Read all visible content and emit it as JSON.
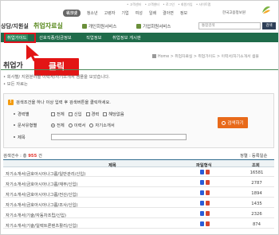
{
  "top_links": [
    "• 고객센터",
    "• 고객센터",
    "• 로그인",
    "• 회원가입",
    "• 사이트맵"
  ],
  "gnb": {
    "items": [
      "워크넷",
      "청소년",
      "고령자",
      "기업",
      "여성",
      "일배",
      "결아면",
      "정보"
    ],
    "active_index": 0
  },
  "logo": {
    "text": "한국고용정보원"
  },
  "row2": {
    "title_part1": "상담/지원실",
    "title_part2": "취업자료실",
    "tab1": "개인회원서비스",
    "tab2": "기업회원서비스",
    "search_placeholder": "통합검색",
    "search_button": "검색"
  },
  "green_nav": {
    "items": [
      "취업가이드",
      "선호직종/임금정보",
      "직업정보",
      "취업정보 게시판"
    ],
    "selected_index": 0
  },
  "click_badge": "클릭",
  "breadcrumb": "Home > 취업자료실 > 취업가이드 > 이력서/자기소개서 샘플",
  "page_title": "취업가",
  "description": [
    "• 회사별/ 지원분야별 이력서/자기소개서 샘플을 모았습니다.",
    "• 모든 자료는"
  ],
  "search_panel": {
    "guide": "검색조건을 하나 이상 입력 후 검색버튼을 클릭하세요.",
    "career_label": "경력별",
    "career_options": [
      "전체",
      "신입",
      "경력",
      "해당없음"
    ],
    "doc_label": "문서유형별",
    "doc_options": [
      "전체",
      "이력서",
      "자기소개서"
    ],
    "doc_selected_index": 0,
    "title_label": "제목",
    "title_value": "",
    "search_button": "검색하기"
  },
  "results": {
    "count_prefix": "검색건수 : 총",
    "count_value": "955",
    "count_suffix": "건",
    "sort_text": "정렬 : 등록일순",
    "headers": {
      "title": "제목",
      "file": "파일형식",
      "views": "조회"
    },
    "rows": [
      {
        "title": "자기소개서(금호아시아나그룹/일반관리/신입)",
        "views": "16581"
      },
      {
        "title": "자기소개서(금호아시아나그룹/재무/신입)",
        "views": "2787"
      },
      {
        "title": "자기소개서(금호아시아나그룹/전산/신입)",
        "views": "1894"
      },
      {
        "title": "자기소개서(금호아시아나그룹/조사/신입)",
        "views": "1435"
      },
      {
        "title": "자기소개서(기술/자동차조립/신입)",
        "views": "2326"
      },
      {
        "title": "자기소개서(기술/일렉트론텐츠활리/신입)",
        "views": "874"
      }
    ]
  },
  "colors": {
    "green_nav": "#1f6b4a",
    "accent_red": "#e31515",
    "search_orange": "#e86a1a",
    "count_red": "#e3312b"
  }
}
